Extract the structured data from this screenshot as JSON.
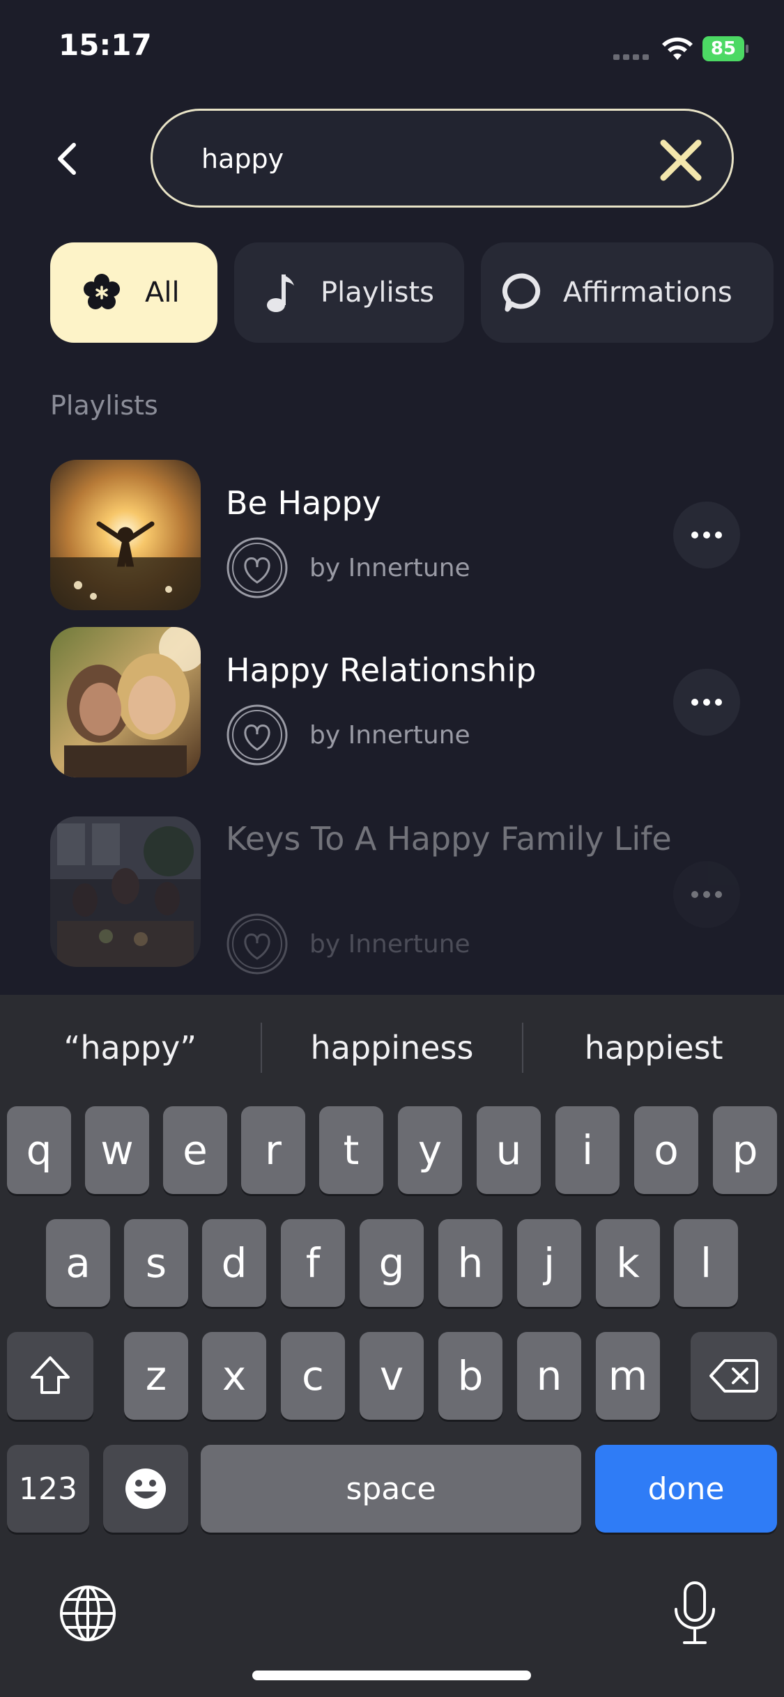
{
  "status_bar": {
    "time": "15:17",
    "battery": "85"
  },
  "search": {
    "value": "happy",
    "placeholder": ""
  },
  "filters": [
    {
      "label": "All",
      "icon": "flower-icon",
      "active": true
    },
    {
      "label": "Playlists",
      "icon": "music-note-icon",
      "active": false
    },
    {
      "label": "Affirmations",
      "icon": "chat-bubble-icon",
      "active": false
    }
  ],
  "section_title": "Playlists",
  "playlists": [
    {
      "title": "Be Happy",
      "author": "by Innertune"
    },
    {
      "title": "Happy Relationship",
      "author": "by Innertune"
    },
    {
      "title": "Keys To A Happy Family Life",
      "author": "by Innertune"
    }
  ],
  "keyboard": {
    "suggestions": [
      "“happy”",
      "happiness",
      "happiest"
    ],
    "row1": [
      "q",
      "w",
      "e",
      "r",
      "t",
      "y",
      "u",
      "i",
      "o",
      "p"
    ],
    "row2": [
      "a",
      "s",
      "d",
      "f",
      "g",
      "h",
      "j",
      "k",
      "l"
    ],
    "row3": [
      "z",
      "x",
      "c",
      "v",
      "b",
      "n",
      "m"
    ],
    "numbers_label": "123",
    "space_label": "space",
    "done_label": "done"
  },
  "colors": {
    "accent_chip": "#fdf3c8",
    "done_key": "#2f7cf6",
    "background": "#1c1d29"
  }
}
